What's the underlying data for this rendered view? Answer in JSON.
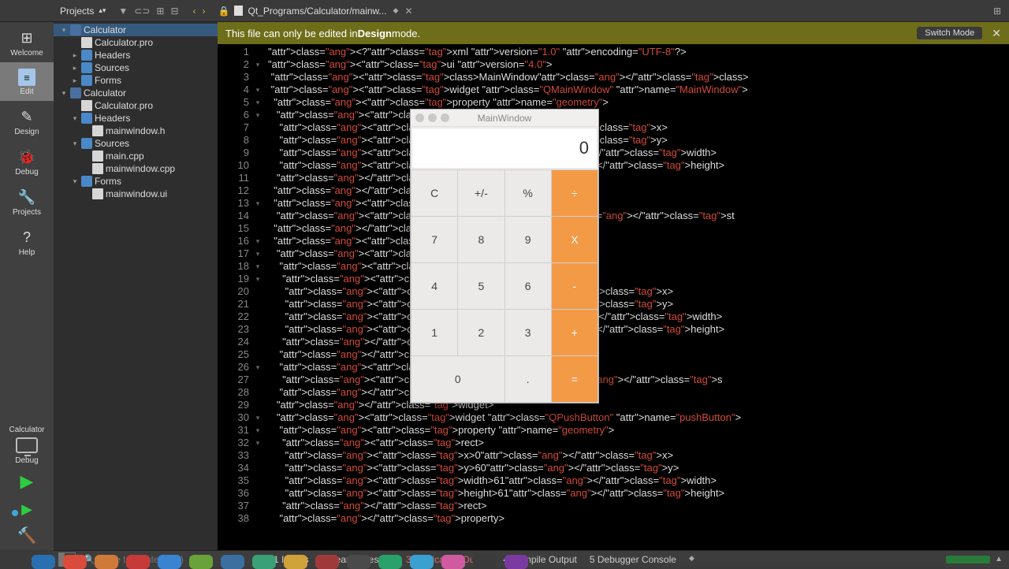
{
  "topbar": {
    "projects_label": "Projects",
    "breadcrumb": "Qt_Programs/Calculator/mainw..."
  },
  "modes": {
    "welcome": "Welcome",
    "edit": "Edit",
    "design": "Design",
    "debug": "Debug",
    "projects": "Projects",
    "help": "Help",
    "target_project": "Calculator",
    "target_mode": "Debug"
  },
  "tree": {
    "root1": "Calculator",
    "root1_pro": "Calculator.pro",
    "root1_headers": "Headers",
    "root1_sources": "Sources",
    "root1_forms": "Forms",
    "root2": "Calculator",
    "root2_pro": "Calculator.pro",
    "root2_headers": "Headers",
    "root2_headers_mainh": "mainwindow.h",
    "root2_sources": "Sources",
    "root2_sources_main": "main.cpp",
    "root2_sources_mw": "mainwindow.cpp",
    "root2_forms": "Forms",
    "root2_forms_ui": "mainwindow.ui"
  },
  "banner": {
    "prefix": "This file can only be edited in ",
    "bold": "Design",
    "suffix": " mode.",
    "switch": "Switch Mode"
  },
  "code": {
    "lines": [
      "<?xml version=\"1.0\" encoding=\"UTF-8\"?>",
      "<ui version=\"4.0\">",
      " <class>MainWindow</class>",
      " <widget class=\"QMainWindow\" name=\"MainWindow\">",
      "  <property name=\"geometry\">",
      "   <rect>",
      "    <x>0</x>",
      "    <y>0</y>",
      "    <width>400</width>",
      "    <height>342</height>",
      "   </rect>",
      "  </property>",
      "  <property name=\"windowT",
      "   <string>MainWindow</st",
      "  </property>",
      "  <widget class=\"QWidget\"",
      "   <widget class=\"QLabel\"",
      "    <property name=\"geome",
      "     <rect>",
      "      <x>0</x>",
      "      <y>0</y>",
      "      <width>241</width>",
      "      <height>61</height>",
      "     </rect>",
      "    </property>",
      "    <property name=\"text\"",
      "     <string>TextLabel</s",
      "    </property>",
      "   </widget>",
      "   <widget class=\"QPushButton\" name=\"pushButton\">",
      "    <property name=\"geometry\">",
      "     <rect>",
      "      <x>0</x>",
      "      <y>60</y>",
      "      <width>61</width>",
      "      <height>61</height>",
      "     </rect>",
      "    </property>"
    ]
  },
  "calc": {
    "title": "MainWindow",
    "display": "0",
    "keys": {
      "c": "C",
      "pm": "+/-",
      "pct": "%",
      "div": "÷",
      "7": "7",
      "8": "8",
      "9": "9",
      "mul": "X",
      "4": "4",
      "5": "5",
      "6": "6",
      "sub": "-",
      "1": "1",
      "2": "2",
      "3": "3",
      "add": "+",
      "0": "0",
      "dot": ".",
      "eq": "="
    }
  },
  "status": {
    "search_placeholder": "Type to locate (⌘K)",
    "p1": "1  Issues",
    "p2": "2  Search Results",
    "p3": "3  Application Output",
    "p4": "4  Compile Output",
    "p5": "5  Debugger Console"
  }
}
